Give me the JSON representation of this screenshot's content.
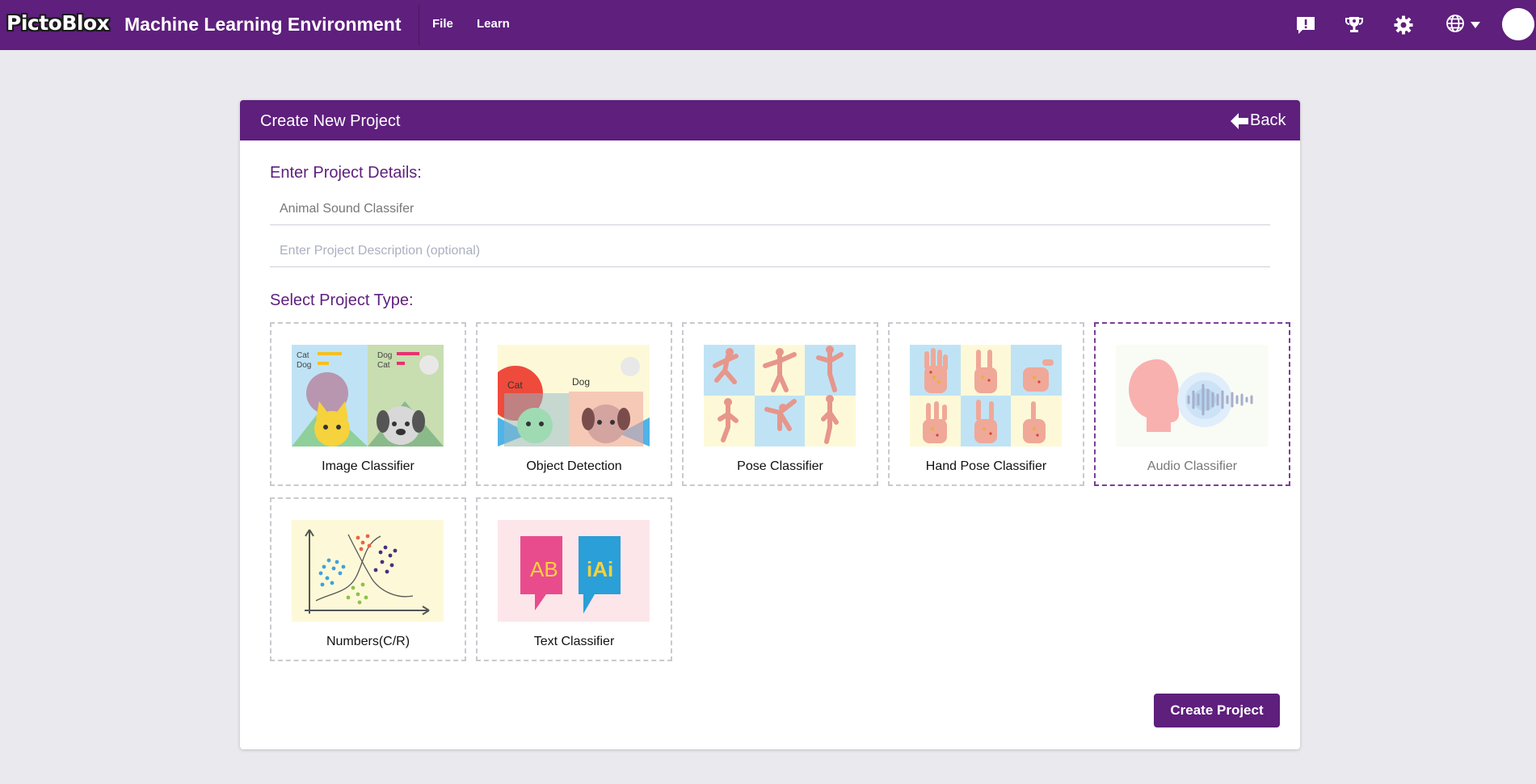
{
  "header": {
    "logo_text": "PictoBlox",
    "app_title": "Machine Learning Environment",
    "menu": [
      {
        "label": "File"
      },
      {
        "label": "Learn"
      }
    ],
    "icons": [
      "feedback-icon",
      "trophy-icon",
      "gear-icon",
      "globe-icon",
      "chevron-down-icon",
      "avatar-icon"
    ]
  },
  "dialog": {
    "title": "Create New Project",
    "back_label": "Back",
    "details_label": "Enter Project Details:",
    "project_name_value": "Animal Sound Classifer",
    "project_description_placeholder": "Enter Project Description (optional)",
    "type_label": "Select Project Type:",
    "project_types": [
      {
        "label": "Image Classifier",
        "selected": false
      },
      {
        "label": "Object Detection",
        "selected": false
      },
      {
        "label": "Pose Classifier",
        "selected": false
      },
      {
        "label": "Hand Pose Classifier",
        "selected": false
      },
      {
        "label": "Audio Classifier",
        "selected": true
      },
      {
        "label": "Numbers(C/R)",
        "selected": false
      },
      {
        "label": "Text Classifier",
        "selected": false
      }
    ],
    "image_labels": {
      "image_classifier": [
        "Cat",
        "Dog",
        "Dog",
        "Cat"
      ],
      "object_detection": [
        "Cat",
        "Dog"
      ],
      "text_classifier": [
        "AB",
        "iAi"
      ]
    },
    "create_button_label": "Create Project"
  },
  "colors": {
    "brand_purple": "#5e1f7d",
    "page_background": "#e9e9ee",
    "selected_border": "#7a3d98"
  }
}
